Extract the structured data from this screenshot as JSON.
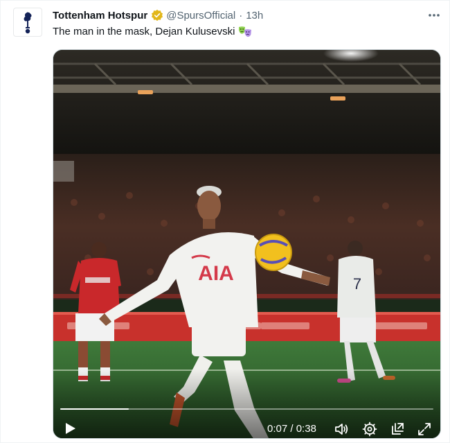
{
  "tweet": {
    "author_name": "Tottenham Hotspur",
    "handle": "@SpursOfficial",
    "separator": "·",
    "timestamp": "13h",
    "text": "The man in the mask, Dejan Kulusevski",
    "avatar_icon": "spurs-cockerel-icon",
    "verified_color": "#e2b719",
    "accent": "#1d9bf0"
  },
  "video": {
    "current_time": "0:07",
    "duration": "0:38",
    "time_separator": "/",
    "progress_fraction": 0.184,
    "jersey_sponsor": "AIA",
    "icons": [
      "play-icon",
      "volume-icon",
      "settings-icon",
      "pip-icon",
      "fullscreen-icon"
    ]
  }
}
